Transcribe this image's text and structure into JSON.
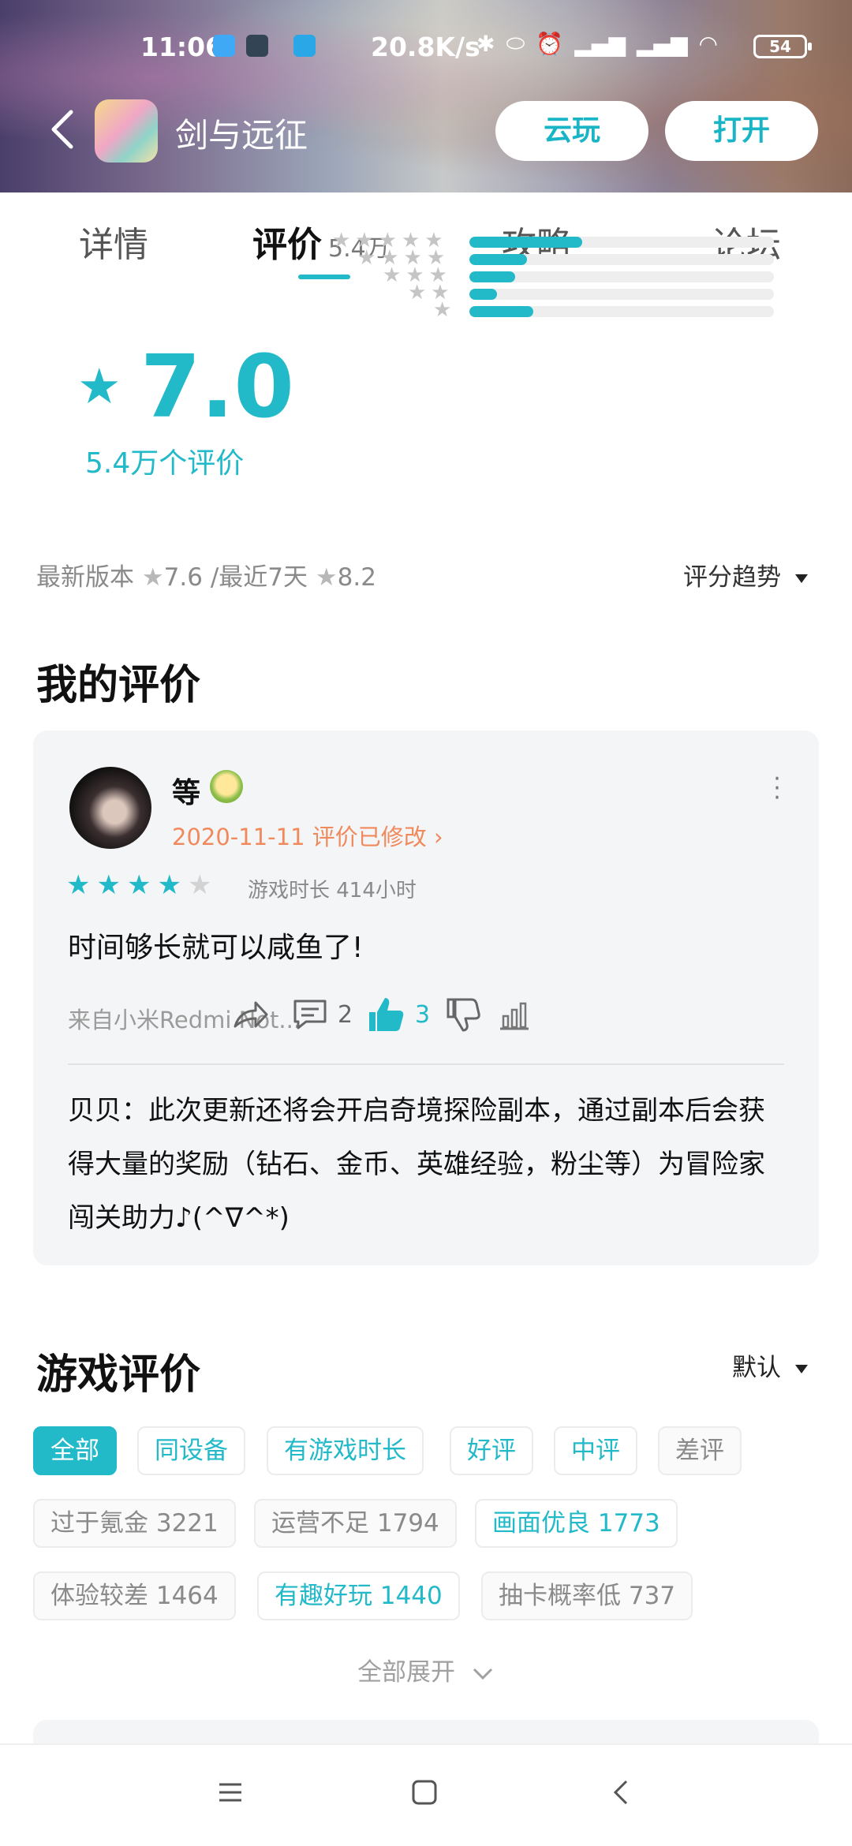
{
  "status": {
    "time": "11:06",
    "speed": "20.8K/s",
    "battery": "54"
  },
  "header": {
    "title": "剑与远征",
    "cloud_play": "云玩",
    "open": "打开"
  },
  "tabs": [
    {
      "label": "详情"
    },
    {
      "label": "评价",
      "count": "5.4万"
    },
    {
      "label": "攻略"
    },
    {
      "label": "论坛"
    }
  ],
  "score": {
    "value": "7.0",
    "count_label": "5.4万个评价",
    "distribution": [
      0.37,
      0.19,
      0.15,
      0.09,
      0.21
    ]
  },
  "version": {
    "latest_label": "最新版本",
    "latest_score": "7.6",
    "recent_label": "/最近7天",
    "recent_score": "8.2",
    "trend_label": "评分趋势"
  },
  "my_review": {
    "section_title": "我的评价",
    "user_name": "等",
    "date_line": "2020-11-11 评价已修改",
    "stars_on": 4,
    "playtime": "游戏时长 414小时",
    "text": "时间够长就可以咸鱼了!",
    "device": "来自小米Redmi Not...",
    "comments": "2",
    "likes": "3",
    "reply": "贝贝：此次更新还将会开启奇境探险副本，通过副本后会获得大量的奖励（钻石、金币、英雄经验，粉尘等）为冒险家闯关助力♪(^∇^*)"
  },
  "game_reviews": {
    "section_title": "游戏评价",
    "sort_label": "默认",
    "filters_row1": [
      "全部",
      "同设备",
      "有游戏时长",
      "好评",
      "中评",
      "差评"
    ],
    "tags_row2": [
      "过于氪金 3221",
      "运营不足 1794",
      "画面优良 1773"
    ],
    "tags_row3": [
      "体验较差 1464",
      "有趣好玩 1440",
      "抽卡概率低 737"
    ],
    "expand_label": "全部展开"
  },
  "colors": {
    "accent": "#22b9c9",
    "date": "#f08a5d"
  }
}
